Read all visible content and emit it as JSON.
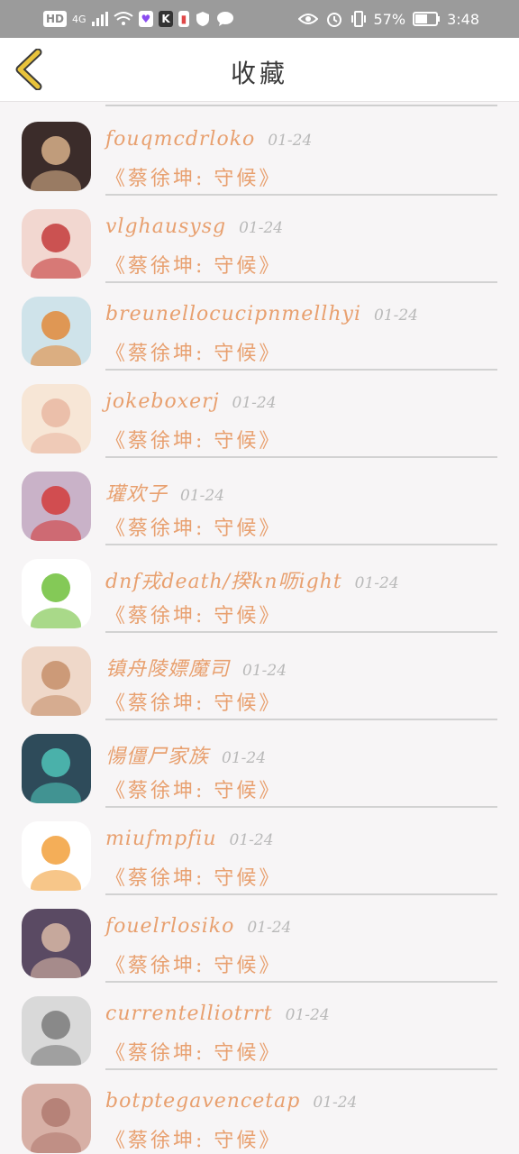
{
  "status_bar": {
    "network": "HD",
    "signal_label": "4G",
    "app_icon_k": "K",
    "battery_percent": "57%",
    "time": "3:48"
  },
  "header": {
    "title": "收藏",
    "back_icon": "chevron-left-icon",
    "accent": "#e8c33b"
  },
  "favorites": [
    {
      "name": "fouqmcdrloko",
      "date": "01-24",
      "song": "《蔡徐坤: 守候》",
      "avatar_bg": "#3b2c2a",
      "avatar_fg": "#d8b08a"
    },
    {
      "name": "vlghausysg",
      "date": "01-24",
      "song": "《蔡徐坤: 守候》",
      "avatar_bg": "#f2d7d0",
      "avatar_fg": "#c43b3b"
    },
    {
      "name": "breunellocucipnmellhyi",
      "date": "01-24",
      "song": "《蔡徐坤: 守候》",
      "avatar_bg": "#cfe3ea",
      "avatar_fg": "#e28a3a"
    },
    {
      "name": "jokeboxerj",
      "date": "01-24",
      "song": "《蔡徐坤: 守候》",
      "avatar_bg": "#f7e6d6",
      "avatar_fg": "#e9b7a2"
    },
    {
      "name": "瓘欢子",
      "date": "01-24",
      "song": "《蔡徐坤: 守候》",
      "avatar_bg": "#c9b2c8",
      "avatar_fg": "#d23b3b"
    },
    {
      "name": "dnf戎death/揆kn呖ight",
      "date": "01-24",
      "song": "《蔡徐坤: 守候》",
      "avatar_bg": "#ffffff",
      "avatar_fg": "#6fbf3a"
    },
    {
      "name": "镇舟陵嫖魔司",
      "date": "01-24",
      "song": "《蔡徐坤: 守候》",
      "avatar_bg": "#efd8c9",
      "avatar_fg": "#c58f6a"
    },
    {
      "name": "愓僵尸家族",
      "date": "01-24",
      "song": "《蔡徐坤: 守候》",
      "avatar_bg": "#2e4b5a",
      "avatar_fg": "#4fc3b8"
    },
    {
      "name": "miufmpfiu",
      "date": "01-24",
      "song": "《蔡徐坤: 守候》",
      "avatar_bg": "#ffffff",
      "avatar_fg": "#f2a03b"
    },
    {
      "name": "fouelrlosiko",
      "date": "01-24",
      "song": "《蔡徐坤: 守候》",
      "avatar_bg": "#5a4a63",
      "avatar_fg": "#d9b8a6"
    },
    {
      "name": "currentelliotrrt",
      "date": "01-24",
      "song": "《蔡徐坤: 守候》",
      "avatar_bg": "#d9d9d9",
      "avatar_fg": "#7a7a7a"
    },
    {
      "name": "botptegavencetap",
      "date": "01-24",
      "song": "《蔡徐坤: 守候》",
      "avatar_bg": "#d7b0a6",
      "avatar_fg": "#b07a70"
    }
  ],
  "colors": {
    "name_color": "#e8a06f",
    "date_color": "#b9b9b9",
    "separator": "#d2d2d2",
    "background": "#f7f5f6"
  }
}
